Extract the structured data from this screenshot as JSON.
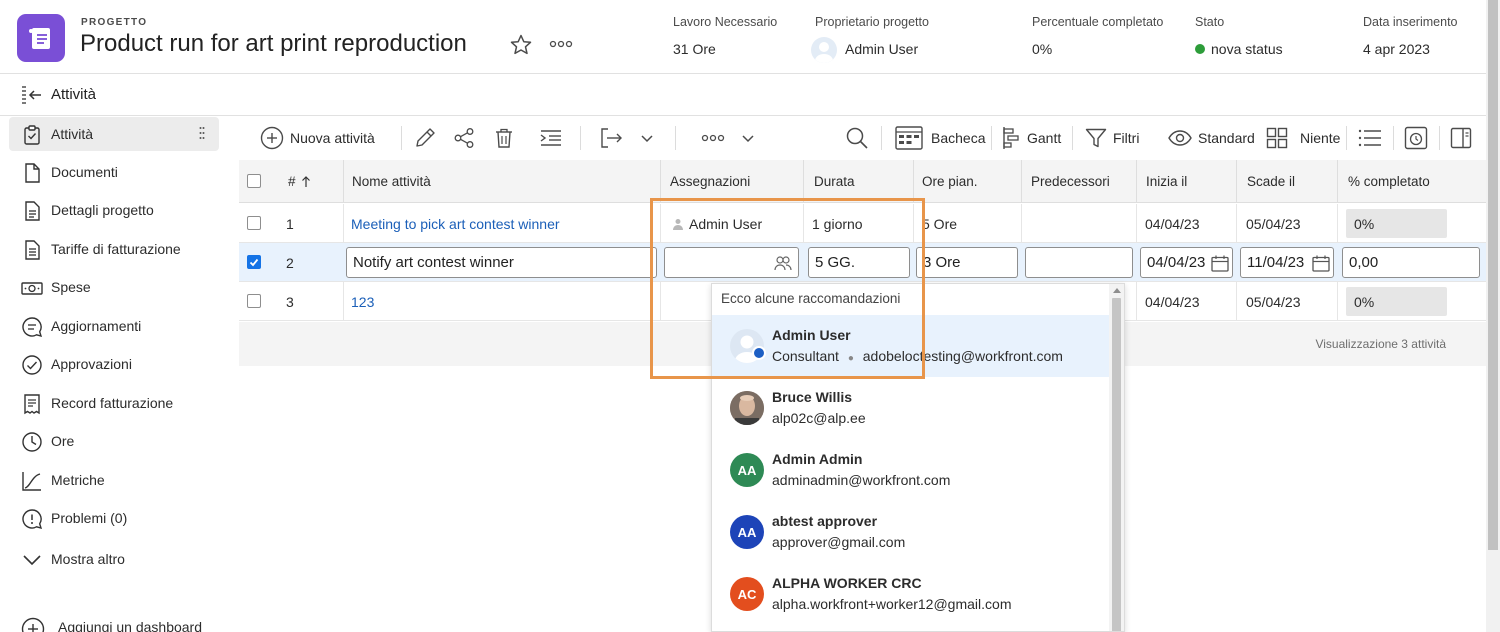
{
  "header": {
    "project_label": "PROGETTO",
    "project_title": "Product run for art print reproduction",
    "meta": {
      "work_label": "Lavoro Necessario",
      "work_value": "31 Ore",
      "owner_label": "Proprietario progetto",
      "owner_value": "Admin User",
      "percent_label": "Percentuale completato",
      "percent_value": "0%",
      "status_label": "Stato",
      "status_value": "nova status",
      "date_label": "Data inserimento",
      "date_value": "4 apr 2023"
    },
    "status_color": "#2d9d3a",
    "brand_color": "#7a4fd6"
  },
  "subheader": {
    "title": "Attività"
  },
  "sidebar": {
    "items": [
      {
        "label": "Attività",
        "icon": "clipboard-icon"
      },
      {
        "label": "Documenti",
        "icon": "document-icon"
      },
      {
        "label": "Dettagli progetto",
        "icon": "details-icon"
      },
      {
        "label": "Tariffe di fatturazione",
        "icon": "billing-rate-icon"
      },
      {
        "label": "Spese",
        "icon": "money-icon"
      },
      {
        "label": "Aggiornamenti",
        "icon": "comment-icon"
      },
      {
        "label": "Approvazioni",
        "icon": "check-circle-icon"
      },
      {
        "label": "Record fatturazione",
        "icon": "invoice-icon"
      },
      {
        "label": "Ore",
        "icon": "clock-icon"
      },
      {
        "label": "Metriche",
        "icon": "chart-icon"
      },
      {
        "label": "Problemi (0)",
        "icon": "issue-icon"
      },
      {
        "label": "Mostra altro",
        "icon": "chevron-down-icon"
      },
      {
        "label": "Aggiungi un dashboard",
        "icon": "add-circle-icon"
      }
    ]
  },
  "toolbar": {
    "new_task": "Nuova attività",
    "board": "Bacheca",
    "gantt": "Gantt",
    "filters": "Filtri",
    "view": "Standard",
    "grouping": "Niente"
  },
  "grid": {
    "columns": [
      "#",
      "Nome attività",
      "Assegnazioni",
      "Durata",
      "Ore pian.",
      "Predecessori",
      "Inizia il",
      "Scade il",
      "% completato"
    ],
    "rows": [
      {
        "num": "1",
        "name": "Meeting to pick art contest winner",
        "assignment": "Admin User",
        "duration": "1 giorno",
        "hours": "5 Ore",
        "predecessors": "",
        "start": "04/04/23",
        "due": "05/04/23",
        "percent": "0%"
      },
      {
        "num": "2",
        "name": "Notify art contest winner",
        "assignment": "",
        "duration": "5 GG.",
        "hours": "3 Ore",
        "predecessors": "",
        "start": "04/04/23",
        "due": "11/04/23",
        "percent": "0,00"
      },
      {
        "num": "3",
        "name": "123",
        "assignment": "",
        "duration": "",
        "hours": "",
        "predecessors": "",
        "start": "04/04/23",
        "due": "05/04/23",
        "percent": "0%"
      }
    ],
    "footer": "Visualizzazione 3 attività"
  },
  "dropdown": {
    "title": "Ecco alcune raccomandazioni",
    "options": [
      {
        "name": "Admin User",
        "role": "Consultant",
        "email": "adobeloctesting@workfront.com",
        "initials": "",
        "color": "#dde7f3"
      },
      {
        "name": "Bruce Willis",
        "role": "",
        "email": "alp02c@alp.ee",
        "initials": "",
        "color": "#8a7a6e"
      },
      {
        "name": "Admin Admin",
        "role": "",
        "email": "adminadmin@workfront.com",
        "initials": "AA",
        "color": "#2e8a55"
      },
      {
        "name": "abtest approver",
        "role": "",
        "email": "approver@gmail.com",
        "initials": "AA",
        "color": "#1d44b8"
      },
      {
        "name": "ALPHA WORKER CRC",
        "role": "",
        "email": "alpha.workfront+worker12@gmail.com",
        "initials": "AC",
        "color": "#e34e1e"
      }
    ]
  }
}
